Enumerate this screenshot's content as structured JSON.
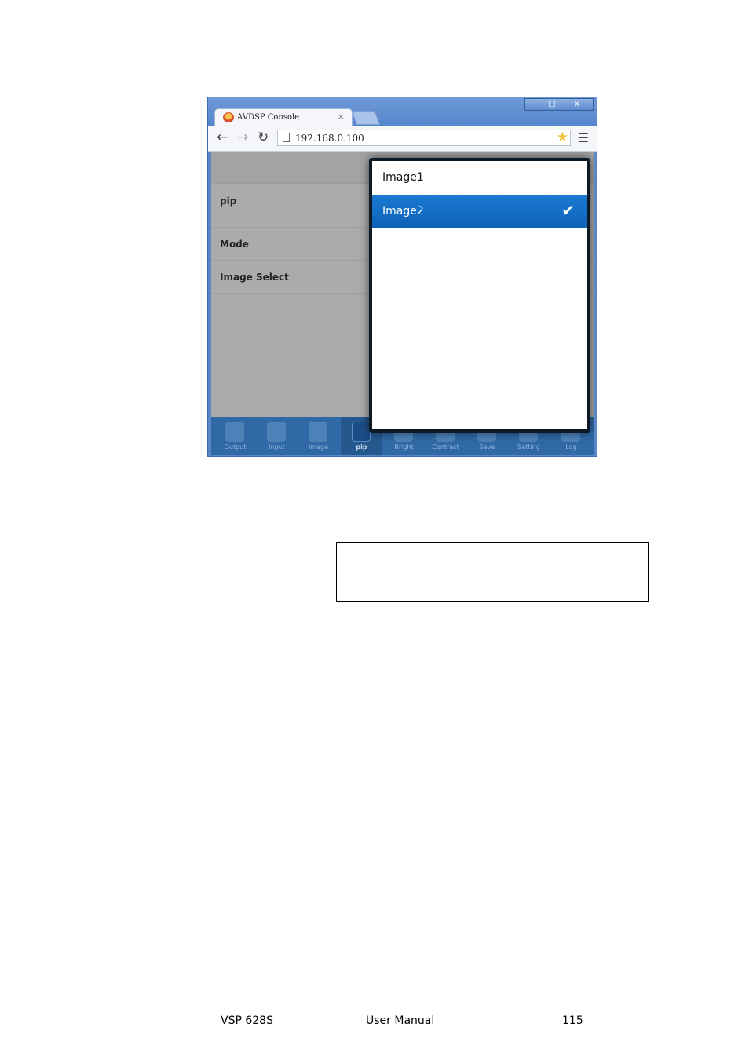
{
  "browser": {
    "tab_title": "AVDSP Console",
    "tab_close": "×",
    "url": "192.168.0.100",
    "window_controls": {
      "minimize": "–",
      "maximize": "□",
      "close": "x"
    }
  },
  "app": {
    "rows": [
      {
        "label": "pip"
      },
      {
        "label": "Mode"
      },
      {
        "label": "Image Select"
      }
    ],
    "footer_buttons": [
      {
        "label": "Output",
        "icon": "output-icon"
      },
      {
        "label": "Input",
        "icon": "input-icon"
      },
      {
        "label": "Image",
        "icon": "image-icon"
      },
      {
        "label": "pip",
        "icon": "pip-icon",
        "active": true
      },
      {
        "label": "Bright",
        "icon": "bright-icon"
      },
      {
        "label": "Contrast",
        "icon": "contrast-icon"
      },
      {
        "label": "Save",
        "icon": "save-icon"
      },
      {
        "label": "Setting",
        "icon": "setting-icon"
      },
      {
        "label": "Log",
        "icon": "log-icon"
      }
    ]
  },
  "popup": {
    "options": [
      {
        "label": "Image1",
        "selected": false
      },
      {
        "label": "Image2",
        "selected": true
      }
    ],
    "check": "✔"
  },
  "page_footer": {
    "model": "VSP 628S",
    "doc": "User Manual",
    "page": "115"
  },
  "colors": {
    "accent": "#0c62b6",
    "footer_bar": "#2f6aa6",
    "app_bg": "#ababab"
  }
}
